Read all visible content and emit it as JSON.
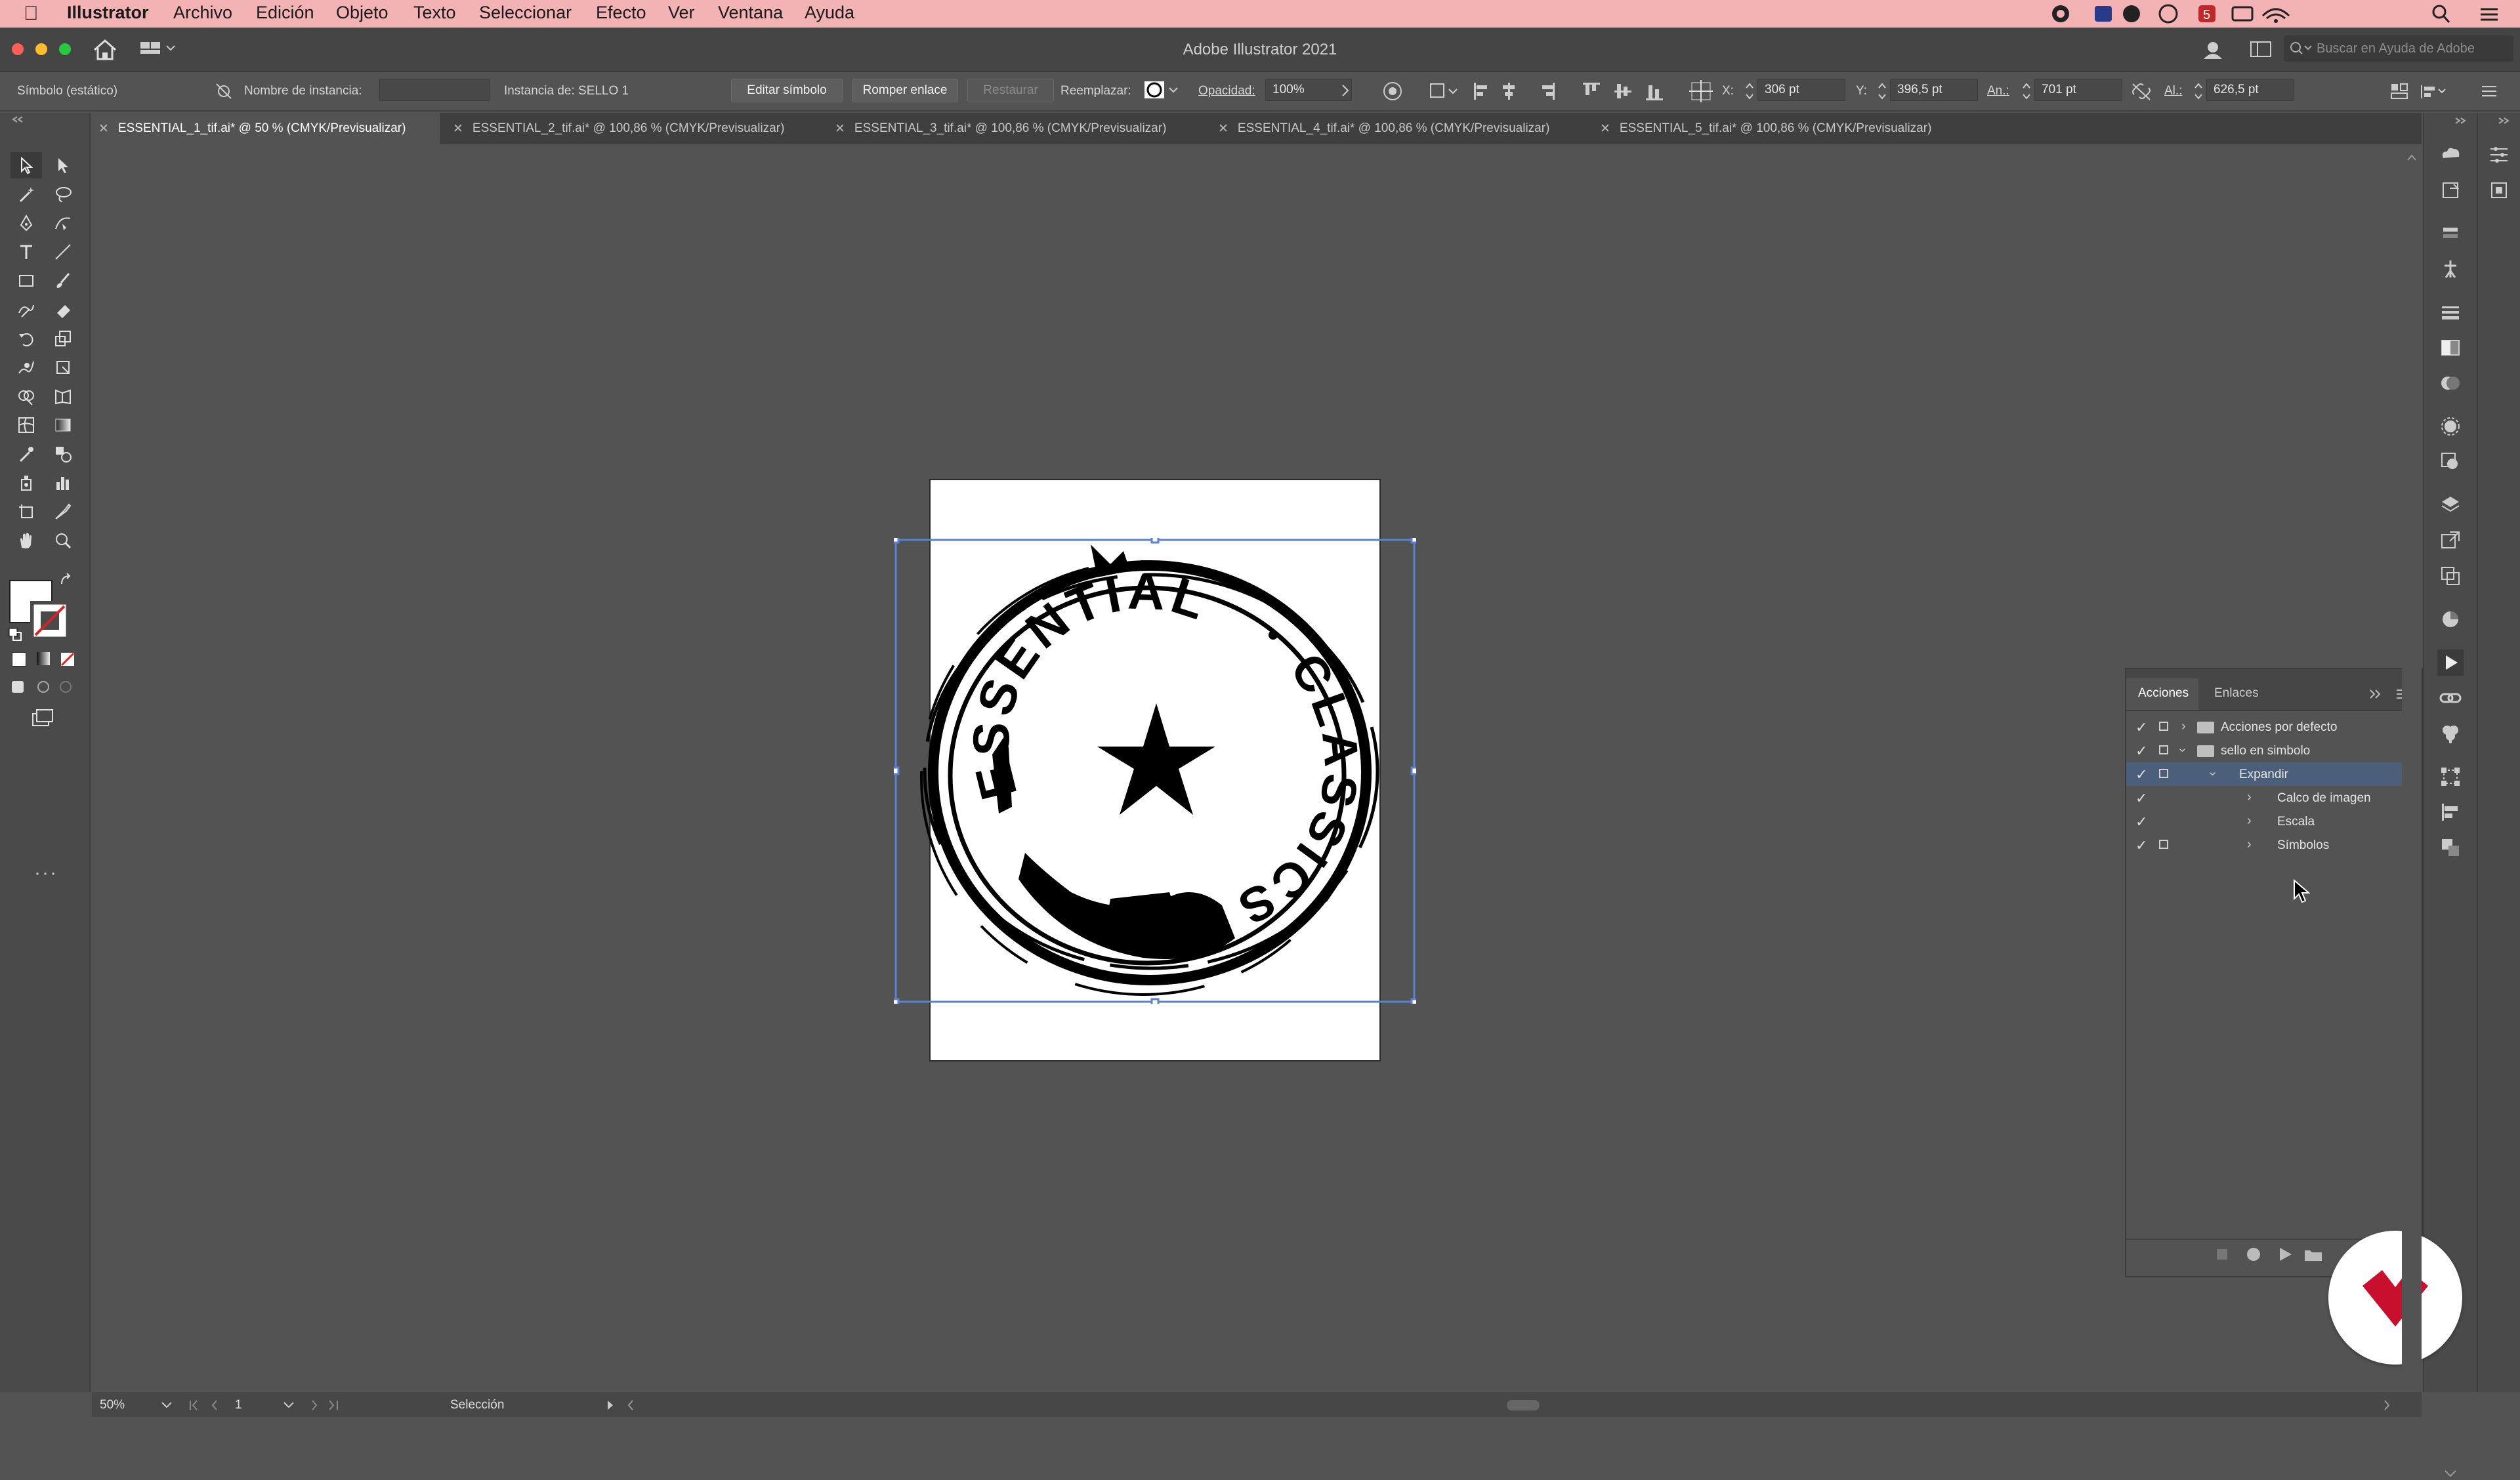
{
  "menubar": {
    "app": "Illustrator",
    "items": [
      "Archivo",
      "Edición",
      "Objeto",
      "Texto",
      "Seleccionar",
      "Efecto",
      "Ver",
      "Ventana",
      "Ayuda"
    ]
  },
  "titlebar": {
    "title": "Adobe Illustrator 2021",
    "search_placeholder": "Buscar en Ayuda de Adobe"
  },
  "control": {
    "object_type": "Símbolo (estático)",
    "instance_name_label": "Nombre de instancia:",
    "instance_name_value": "",
    "instance_of": "Instancia de: SELLO 1",
    "edit_symbol": "Editar símbolo",
    "break_link": "Romper enlace",
    "reset": "Restaurar",
    "replace_label": "Reemplazar:",
    "opacity_label": "Opacidad:",
    "opacity_value": "100%",
    "x_label": "X:",
    "x_value": "306 pt",
    "y_label": "Y:",
    "y_value": "396,5 pt",
    "w_label": "An.:",
    "w_value": "701 pt",
    "h_label": "Al.:",
    "h_value": "626,5 pt"
  },
  "tabs": [
    {
      "label": "ESSENTIAL_1_tif.ai* @ 50 % (CMYK/Previsualizar)",
      "active": true
    },
    {
      "label": "ESSENTIAL_2_tif.ai* @ 100,86 % (CMYK/Previsualizar)",
      "active": false
    },
    {
      "label": "ESSENTIAL_3_tif.ai* @ 100,86 % (CMYK/Previsualizar)",
      "active": false
    },
    {
      "label": "ESSENTIAL_4_tif.ai* @ 100,86 % (CMYK/Previsualizar)",
      "active": false
    },
    {
      "label": "ESSENTIAL_5_tif.ai* @ 100,86 % (CMYK/Previsualizar)",
      "active": false
    }
  ],
  "stamp": {
    "top_text": "ESSENTIAL",
    "bottom_text": "CLASSICS"
  },
  "panel": {
    "tabs": [
      "Acciones",
      "Enlaces"
    ],
    "active_tab": "Acciones",
    "rows": [
      {
        "label": "Acciones por defecto",
        "level": 0,
        "type": "set",
        "expanded": false
      },
      {
        "label": "sello en simbolo",
        "level": 0,
        "type": "set",
        "expanded": true
      },
      {
        "label": "Expandir",
        "level": 1,
        "type": "action",
        "expanded": true,
        "selected": true
      },
      {
        "label": "Calco de imagen",
        "level": 2,
        "type": "command"
      },
      {
        "label": "Escala",
        "level": 2,
        "type": "command"
      },
      {
        "label": "Símbolos",
        "level": 2,
        "type": "command"
      }
    ]
  },
  "status": {
    "zoom": "50%",
    "artboard": "1",
    "tool": "Selección"
  },
  "colors": {
    "menubar": "#f3b2b3",
    "ui_dark": "#535353",
    "selection_blue": "#4a7bd0",
    "badge_red": "#c8102e"
  }
}
